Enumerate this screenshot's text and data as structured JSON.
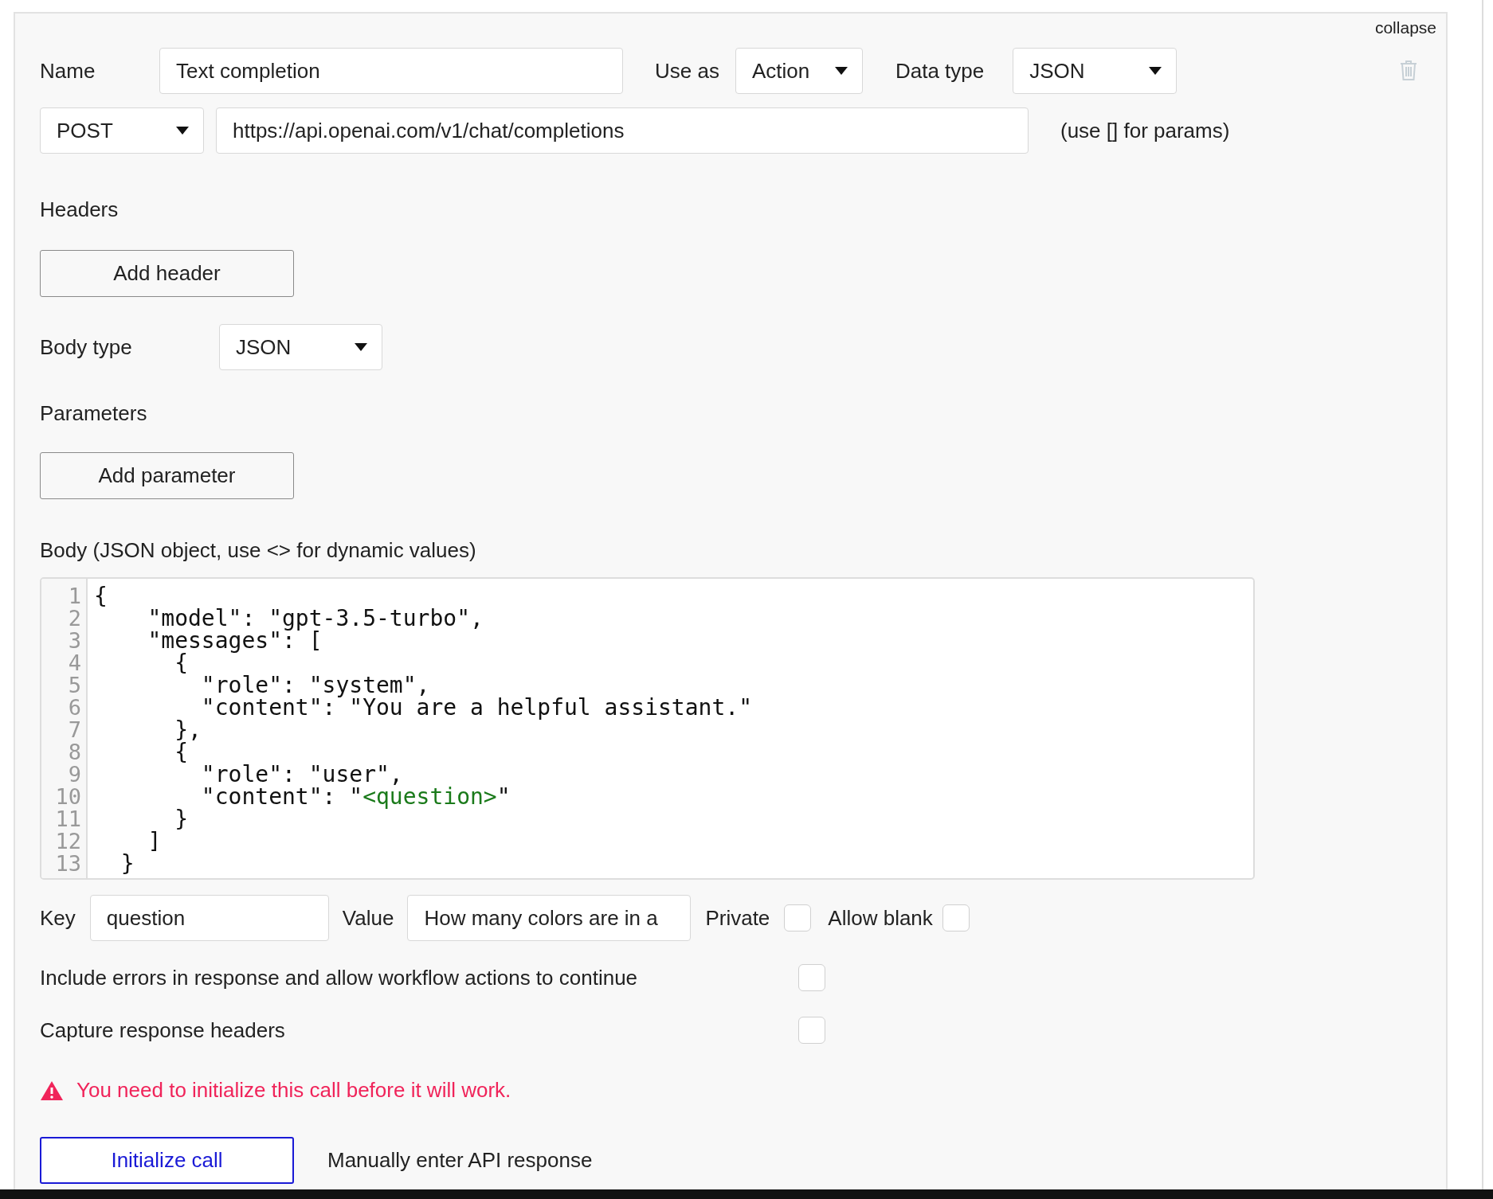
{
  "collapse_link": "collapse",
  "name_field": {
    "label": "Name",
    "value": "Text completion"
  },
  "use_as": {
    "label": "Use as",
    "value": "Action"
  },
  "data_type": {
    "label": "Data type",
    "value": "JSON"
  },
  "method": {
    "value": "POST"
  },
  "url_field": {
    "value": "https://api.openai.com/v1/chat/completions"
  },
  "url_hint": "(use [] for params)",
  "headers": {
    "label": "Headers",
    "button": "Add header"
  },
  "body_type": {
    "label": "Body type",
    "value": "JSON"
  },
  "parameters": {
    "label": "Parameters",
    "button": "Add parameter"
  },
  "body_label": "Body (JSON object, use <> for dynamic values)",
  "code_lines": [
    {
      "number": "1",
      "segments": [
        {
          "kind": "plain",
          "text": "{"
        }
      ]
    },
    {
      "number": "2",
      "segments": [
        {
          "kind": "plain",
          "text": "    \"model\": \"gpt-3.5-turbo\","
        }
      ]
    },
    {
      "number": "3",
      "segments": [
        {
          "kind": "plain",
          "text": "    \"messages\": ["
        }
      ]
    },
    {
      "number": "4",
      "segments": [
        {
          "kind": "plain",
          "text": "      {"
        }
      ]
    },
    {
      "number": "5",
      "segments": [
        {
          "kind": "plain",
          "text": "        \"role\": \"system\","
        }
      ]
    },
    {
      "number": "6",
      "segments": [
        {
          "kind": "plain",
          "text": "        \"content\": \"You are a helpful assistant.\""
        }
      ]
    },
    {
      "number": "7",
      "segments": [
        {
          "kind": "plain",
          "text": "      },"
        }
      ]
    },
    {
      "number": "8",
      "segments": [
        {
          "kind": "plain",
          "text": "      {"
        }
      ]
    },
    {
      "number": "9",
      "segments": [
        {
          "kind": "plain",
          "text": "        \"role\": \"user\","
        }
      ]
    },
    {
      "number": "10",
      "segments": [
        {
          "kind": "plain",
          "text": "        \"content\": \""
        },
        {
          "kind": "dynamic",
          "text": "<question>"
        },
        {
          "kind": "plain",
          "text": "\""
        }
      ]
    },
    {
      "number": "11",
      "segments": [
        {
          "kind": "plain",
          "text": "      }"
        }
      ]
    },
    {
      "number": "12",
      "segments": [
        {
          "kind": "plain",
          "text": "    ]"
        }
      ]
    },
    {
      "number": "13",
      "segments": [
        {
          "kind": "plain",
          "text": "  }"
        }
      ]
    }
  ],
  "param_row": {
    "key_label": "Key",
    "key_value": "question",
    "value_label": "Value",
    "value_value": "How many colors are in a",
    "private": {
      "label": "Private",
      "checked": false
    },
    "allow_blank": {
      "label": "Allow blank",
      "checked": false
    }
  },
  "options": [
    {
      "label": "Include errors in response and allow workflow actions to continue",
      "checked": false
    },
    {
      "label": "Capture response headers",
      "checked": false
    }
  ],
  "warning": "You need to initialize this call before it will work.",
  "initialize_button": "Initialize call",
  "manual_link": "Manually enter API response"
}
